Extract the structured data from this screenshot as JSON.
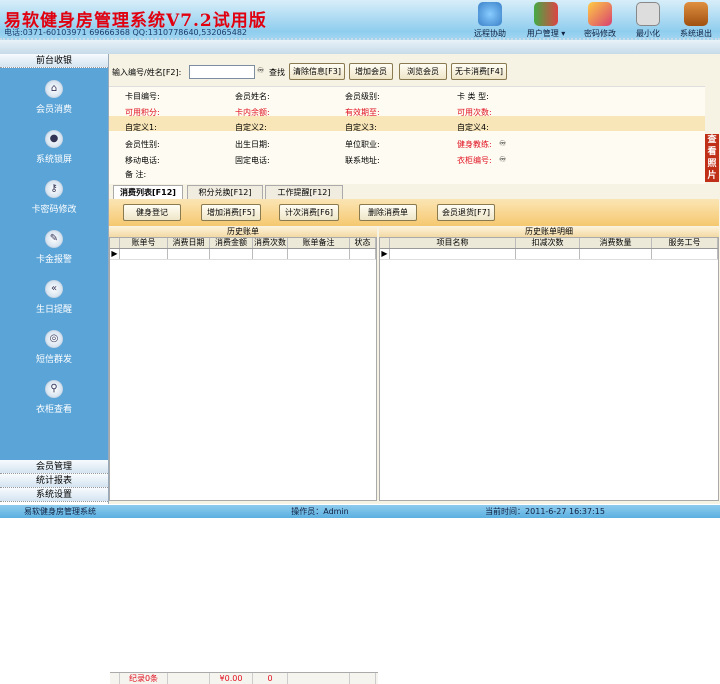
{
  "app": {
    "title": "易软健身房管理系统V7.2试用版",
    "contact": "电话:0371-60103971 69666368 QQ:1310778640,532065482"
  },
  "toolbar": [
    {
      "label": "远程协助",
      "icon": "remote-assist-icon",
      "color": "#3a80c8"
    },
    {
      "label": "用户管理",
      "icon": "users-icon",
      "color": "#d04040"
    },
    {
      "label": "密码修改",
      "icon": "password-edit-icon",
      "color": "#d84070"
    },
    {
      "label": "最小化",
      "icon": "minimize-icon",
      "color": "#9aa"
    },
    {
      "label": "系统退出",
      "icon": "exit-door-icon",
      "color": "#c07020"
    }
  ],
  "sidebar": {
    "header": "前台收银",
    "items": [
      "会员消费",
      "系统锁屏",
      "卡密码修改",
      "卡金报警",
      "生日提醒",
      "短信群发",
      "衣柜查看"
    ],
    "bottom": [
      "会员管理",
      "统计报表",
      "系统设置"
    ]
  },
  "search": {
    "label": "输入编号/姓名[F2]:",
    "value": "",
    "find": "查找",
    "buttons": [
      "清除信息[F3]",
      "增加会员",
      "浏览会员",
      "无卡消费[F4]"
    ]
  },
  "info": {
    "rows": [
      [
        "卡目编号:",
        "会员姓名:",
        "会员级别:",
        "卡 类 型:"
      ],
      [
        "可用积分:",
        "卡内余额:",
        "有效期至:",
        "可用次数:"
      ],
      [
        "自定义1:",
        "自定义2:",
        "自定义3:",
        "自定义4:"
      ],
      [
        "会员性别:",
        "出生日期:",
        "单位职业:",
        "健身教练:"
      ],
      [
        "移动电话:",
        "固定电话:",
        "联系地址:",
        "衣柜编号:"
      ],
      [
        "备   注:"
      ]
    ],
    "photo": "查看照片"
  },
  "tabs": [
    "消费列表[F12]",
    "积分兑换[F12]",
    "工作提醒[F12]"
  ],
  "actions": [
    "健身登记",
    "增加消费[F5]",
    "计次消费[F6]",
    "删除消费单",
    "会员退货[F7]"
  ],
  "history": {
    "caption": "历史账单",
    "columns": [
      "账单号",
      "消费日期",
      "消费金额",
      "消费次数",
      "账单备注",
      "状态"
    ],
    "footer": [
      "纪录0条",
      "",
      "¥0.00",
      "0",
      "",
      ""
    ]
  },
  "detail": {
    "caption": "历史账单明细",
    "columns": [
      "项目名称",
      "扣减次数",
      "消费数量",
      "服务工号"
    ]
  },
  "status": {
    "app": "易软健身房管理系统",
    "operator": "操作员：Admin",
    "time": "当前时间：2011-6-27 16:37:15"
  }
}
